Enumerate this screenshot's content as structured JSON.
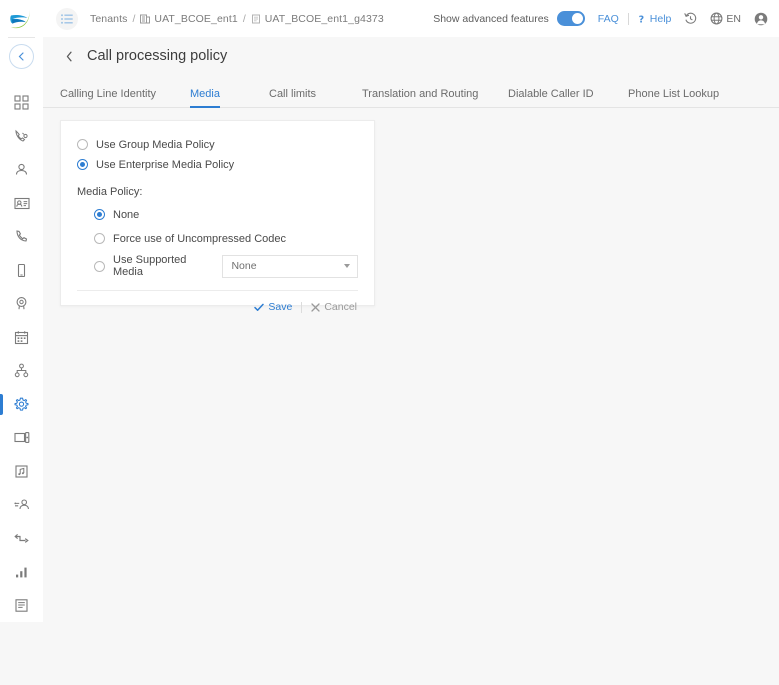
{
  "app": {
    "logo_name": "company-logo",
    "background": "#f7f7f7",
    "accent_color": "#2d7dd2",
    "link_color": "#4a90d9"
  },
  "sidebar": {
    "collapse_icon": "chevron-left-icon",
    "items": [
      {
        "name": "dashboard",
        "icon": "dashboard-grid-icon",
        "active": false
      },
      {
        "name": "call-routing",
        "icon": "phone-network-icon",
        "active": false
      },
      {
        "name": "users",
        "icon": "user-icon",
        "active": false
      },
      {
        "name": "contacts",
        "icon": "id-card-icon",
        "active": false
      },
      {
        "name": "phones",
        "icon": "handset-icon",
        "active": false
      },
      {
        "name": "devices",
        "icon": "mobile-device-icon",
        "active": false
      },
      {
        "name": "voicemail",
        "icon": "microphone-icon",
        "active": false
      },
      {
        "name": "schedules",
        "icon": "calendar-icon",
        "active": false
      },
      {
        "name": "org-hierarchy",
        "icon": "sitemap-icon",
        "active": false
      },
      {
        "name": "settings",
        "icon": "gear-icon",
        "active": true
      },
      {
        "name": "media",
        "icon": "media-device-icon",
        "active": false
      },
      {
        "name": "music-on-hold",
        "icon": "music-note-icon",
        "active": false
      },
      {
        "name": "user-groups",
        "icon": "user-link-icon",
        "active": false
      },
      {
        "name": "call-flow",
        "icon": "flow-arrow-icon",
        "active": false
      },
      {
        "name": "reports",
        "icon": "bar-chart-icon",
        "active": false
      },
      {
        "name": "logs",
        "icon": "document-list-icon",
        "active": false
      }
    ]
  },
  "topbar": {
    "menu_icon": "hamburger-menu-icon",
    "breadcrumb": {
      "root": "Tenants",
      "separator": "/",
      "items": [
        {
          "icon": "building-icon",
          "label": "UAT_BCOE_ent1"
        },
        {
          "icon": "group-icon",
          "label": "UAT_BCOE_ent1_g4373"
        }
      ]
    },
    "advanced_features_label": "Show advanced features",
    "advanced_features_on": true,
    "faq_label": "FAQ",
    "help_label": "Help",
    "help_icon": "question-mark-icon",
    "history_icon": "history-clock-icon",
    "language_icon": "globe-icon",
    "language_code": "EN",
    "account_icon": "account-circle-icon"
  },
  "page": {
    "back_icon": "chevron-left-icon",
    "title": "Call processing policy"
  },
  "tabs": [
    {
      "label": "Calling Line Identity",
      "active": false
    },
    {
      "label": "Media",
      "active": true
    },
    {
      "label": "Call limits",
      "active": false
    },
    {
      "label": "Translation and Routing",
      "active": false
    },
    {
      "label": "Dialable Caller ID",
      "active": false
    },
    {
      "label": "Phone List Lookup",
      "active": false
    }
  ],
  "form": {
    "policy_scope": [
      {
        "label": "Use Group Media Policy",
        "checked": false
      },
      {
        "label": "Use Enterprise Media Policy",
        "checked": true
      }
    ],
    "media_policy_label": "Media Policy:",
    "media_policy_options": [
      {
        "label": "None",
        "checked": true
      },
      {
        "label": "Force use of Uncompressed Codec",
        "checked": false
      },
      {
        "label": "Use Supported Media",
        "checked": false
      }
    ],
    "supported_media_select": {
      "value": "None",
      "caret_icon": "chevron-down-icon"
    },
    "save_label": "Save",
    "save_icon": "check-icon",
    "cancel_label": "Cancel",
    "cancel_icon": "close-x-icon"
  }
}
